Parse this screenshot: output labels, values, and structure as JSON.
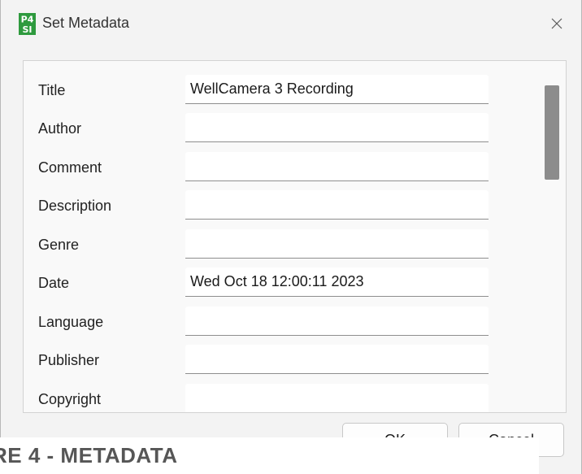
{
  "window": {
    "title": "Set Metadata",
    "logo_text_top": "P4",
    "logo_text_bottom": "SI"
  },
  "fields": [
    {
      "label": "Title",
      "value": "WellCamera 3 Recording"
    },
    {
      "label": "Author",
      "value": ""
    },
    {
      "label": "Comment",
      "value": ""
    },
    {
      "label": "Description",
      "value": ""
    },
    {
      "label": "Genre",
      "value": ""
    },
    {
      "label": "Date",
      "value": "Wed Oct 18 12:00:11 2023"
    },
    {
      "label": "Language",
      "value": ""
    },
    {
      "label": "Publisher",
      "value": ""
    },
    {
      "label": "Copyright",
      "value": ""
    }
  ],
  "buttons": {
    "ok_label": "OK",
    "cancel_label": "Cancel"
  },
  "caption": "RE 4 - METADATA",
  "colors": {
    "logo_green": "#2e9a3e",
    "scrollbar_thumb": "#8c8c8c",
    "dialog_background": "#f3f3f3"
  }
}
